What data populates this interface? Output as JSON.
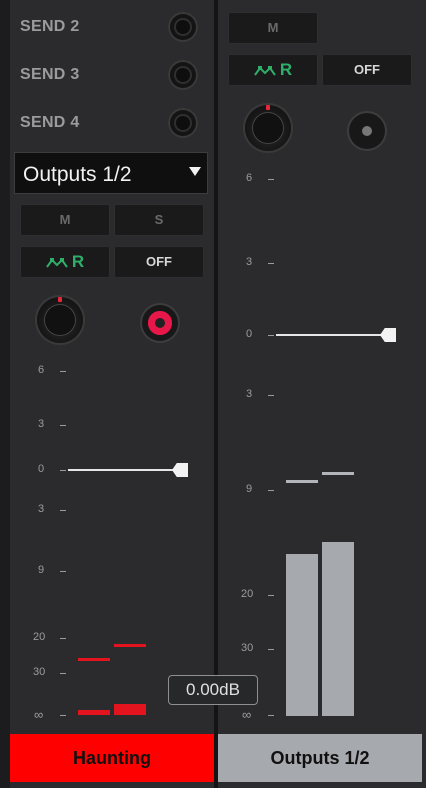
{
  "strip1": {
    "sends": [
      {
        "label": "SEND 2"
      },
      {
        "label": "SEND 3"
      },
      {
        "label": "SEND 4"
      }
    ],
    "output_select": "Outputs 1/2",
    "mute_label": "M",
    "solo_label": "S",
    "automation_label": "R",
    "automation_icon": "automation-read-icon",
    "off_label": "OFF",
    "scale": [
      "6",
      "3",
      "0",
      "3",
      "9",
      "20",
      "30",
      "∞"
    ],
    "fader_level_db": 0,
    "meter_left_peak_db": -27,
    "meter_right_peak_db": -23,
    "db_readout": "0.00dB",
    "name": "Haunting",
    "name_color": "#ff0000"
  },
  "strip2": {
    "mute_label": "M",
    "automation_label": "R",
    "automation_icon": "automation-read-icon",
    "off_label": "OFF",
    "scale": [
      "6",
      "3",
      "0",
      "3",
      "9",
      "20",
      "30",
      "∞"
    ],
    "fader_level_db": 0,
    "name": "Outputs 1/2",
    "name_color": "#a6a9ad"
  },
  "colors": {
    "record_armed": "#e8174a",
    "meter_red": "#e3141e",
    "automation_green": "#2fae6a"
  }
}
